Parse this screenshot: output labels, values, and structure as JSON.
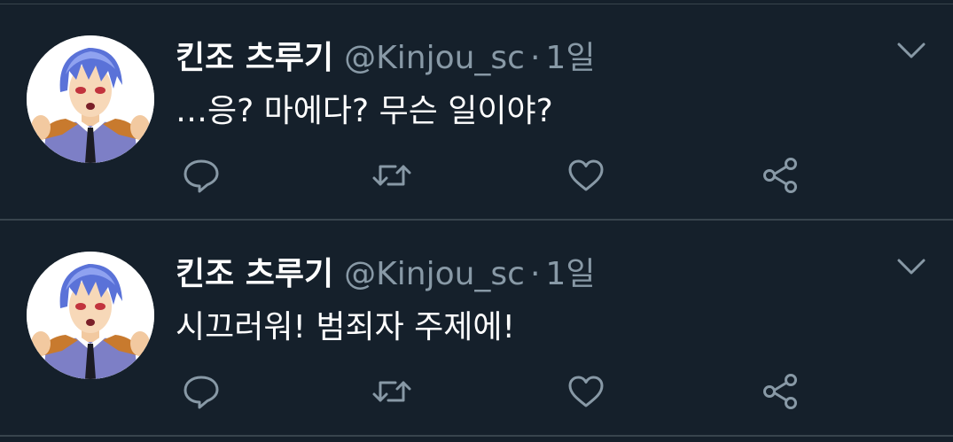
{
  "tweets": [
    {
      "display_name": "킨조 츠루기",
      "handle": "@Kinjou_sc",
      "separator": "·",
      "time": "1일",
      "text": "…응? 마에다? 무슨 일이야?"
    },
    {
      "display_name": "킨조 츠루기",
      "handle": "@Kinjou_sc",
      "separator": "·",
      "time": "1일",
      "text": "시끄러워! 범죄자 주제에!"
    }
  ],
  "colors": {
    "background": "#15202b",
    "divider": "#38444d",
    "primary_text": "#ffffff",
    "secondary_text": "#8899a6",
    "icon": "#8899a6"
  },
  "icons": {
    "menu": "chevron-down-icon",
    "reply": "reply-icon",
    "retweet": "retweet-icon",
    "like": "heart-icon",
    "share": "share-icon"
  }
}
